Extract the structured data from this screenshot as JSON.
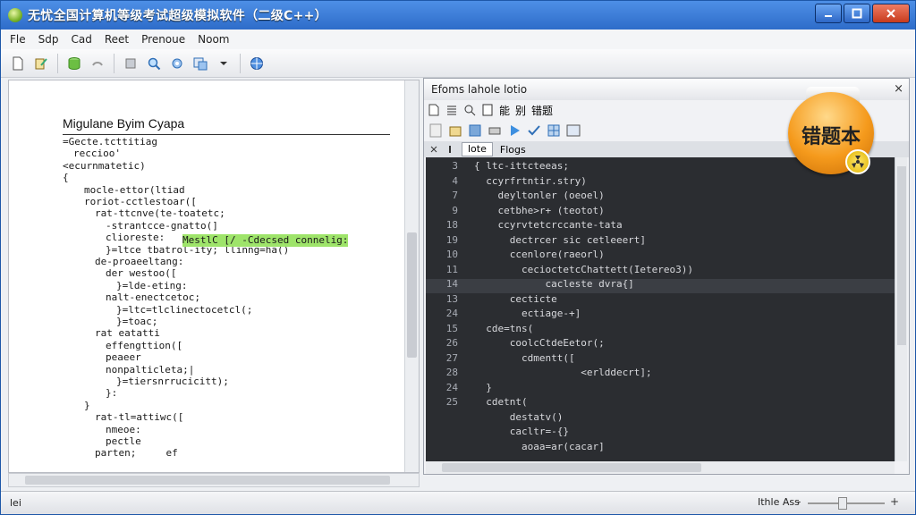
{
  "window": {
    "title": "无忧全国计算机等级考试超级模拟软件（二级C++）"
  },
  "menu": [
    "Fle",
    "Sdp",
    "Cad",
    "Reet",
    "Prenoue",
    "Noom"
  ],
  "left_doc": {
    "heading": "Migulane Byim Cyapa",
    "lines": [
      {
        "indent": 0,
        "text": "=Gecte.tcttitiag"
      },
      {
        "indent": 1,
        "text": "reccioo'"
      },
      {
        "indent": 0,
        "text": "<ecurnmatetic)"
      },
      {
        "indent": 0,
        "text": "{"
      },
      {
        "indent": 2,
        "text": "mocle-ettor(ltiad"
      },
      {
        "indent": 2,
        "text": "roriot-cctlestoar(["
      },
      {
        "indent": 3,
        "text": "rat-ttcnve(te-toatetc;"
      },
      {
        "indent": 4,
        "text": "-strantcce-gnatto(]"
      },
      {
        "indent": 4,
        "text": "clioreste:"
      },
      {
        "indent": 4,
        "text": "}=ltce tbatrol-ity; llinng=ha()"
      },
      {
        "indent": 3,
        "text": "de-proaeeltang:"
      },
      {
        "indent": 4,
        "text": "der westoo(["
      },
      {
        "indent": 5,
        "text": "}=lde-eting:"
      },
      {
        "indent": 4,
        "text": "nalt-enectcetoc;"
      },
      {
        "indent": 5,
        "text": "}=ltc=tlclinectocetcl(;"
      },
      {
        "indent": 5,
        "text": "}=toac;"
      },
      {
        "indent": 3,
        "text": "rat eatatti"
      },
      {
        "indent": 4,
        "text": "effengttion(["
      },
      {
        "indent": 4,
        "text": "peaeer"
      },
      {
        "indent": 4,
        "text": "nonpalticleta;|"
      },
      {
        "indent": 5,
        "text": "}=tiersnrrucicitt);"
      },
      {
        "indent": 4,
        "text": "}:"
      },
      {
        "indent": 2,
        "text": "}"
      },
      {
        "indent": 3,
        "text": "rat-tl=attiwc(["
      },
      {
        "indent": 4,
        "text": "nmeoe:"
      },
      {
        "indent": 4,
        "text": "pectle"
      },
      {
        "indent": 3,
        "text": "parten;     ef"
      }
    ],
    "highlight_text": "MestlC [/ -Cdecsed connelig:"
  },
  "right_panel": {
    "title": "Efoms lahole lotio",
    "toolbar_labels": [
      "能",
      "别",
      "错题"
    ],
    "tabs": [
      "lote",
      "Flogs"
    ],
    "close": "×",
    "gutter": [
      "3",
      "4",
      "7",
      "9",
      "18",
      "19",
      "10",
      "11",
      "14",
      "13",
      "24",
      "15",
      "26",
      "27",
      "28",
      "24",
      "25",
      "",
      "",
      ""
    ],
    "code": [
      "{ ltc-ittcteeas;",
      "  ccyrfrtntir.stry)",
      "    deyltonler (oeoel)",
      "    cetbhe>r+ (teotot)",
      "    ccyrvtetcrccante-tata",
      "      dectrcer sic cetleeert]",
      "      ccenlore(raeorl)",
      "        cecioctetcChattett(Ietereo3))",
      "            cacleste dvra{]",
      "      cecticte",
      "        ectiage-+]",
      "  cde=tns(",
      "      coolcCtdeEetor(;",
      "        cdmentt([",
      "                  <erlddecrt];",
      "  }",
      "  cdetnt(",
      "      destatv()",
      "      cacltr=-{}",
      "        aoaa=ar(cacar]"
    ]
  },
  "badge": {
    "label": "错题本",
    "accent": "#f59a1c"
  },
  "status": {
    "left": "lei",
    "right": "Ithle Ass"
  }
}
